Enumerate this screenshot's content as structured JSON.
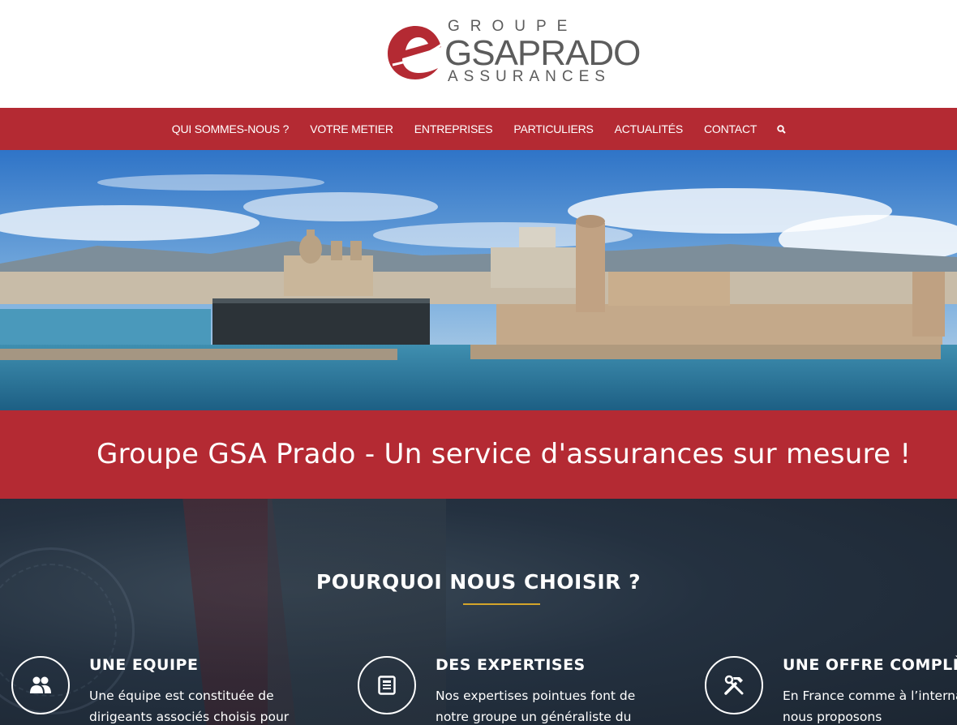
{
  "logo": {
    "top_text": "GROUPE",
    "main_text": "GSAPRADO",
    "bottom_text": "ASSURANCES",
    "brand_color": "#b42a33"
  },
  "nav": {
    "items": [
      {
        "label": "QUI SOMMES-NOUS ?"
      },
      {
        "label": "VOTRE METIER"
      },
      {
        "label": "ENTREPRISES"
      },
      {
        "label": "PARTICULIERS"
      },
      {
        "label": "ACTUALITÉS"
      },
      {
        "label": "CONTACT"
      }
    ],
    "search_icon": "search-icon"
  },
  "banner": {
    "title": "Groupe GSA Prado - Un service d'assurances sur mesure !"
  },
  "why": {
    "title": "POURQUOI NOUS CHOISIR ?",
    "accent_color": "#d4a52a",
    "features": [
      {
        "icon": "team-icon",
        "title": "UNE EQUIPE",
        "text": "Une équipe est constituée de dirigeants associés choisis pour"
      },
      {
        "icon": "document-icon",
        "title": "DES EXPERTISES",
        "text": "Nos expertises pointues font de notre groupe un généraliste du"
      },
      {
        "icon": "tools-icon",
        "title": "UNE OFFRE COMPLÈTE",
        "text": "En France comme à l’international, nous proposons"
      }
    ]
  }
}
